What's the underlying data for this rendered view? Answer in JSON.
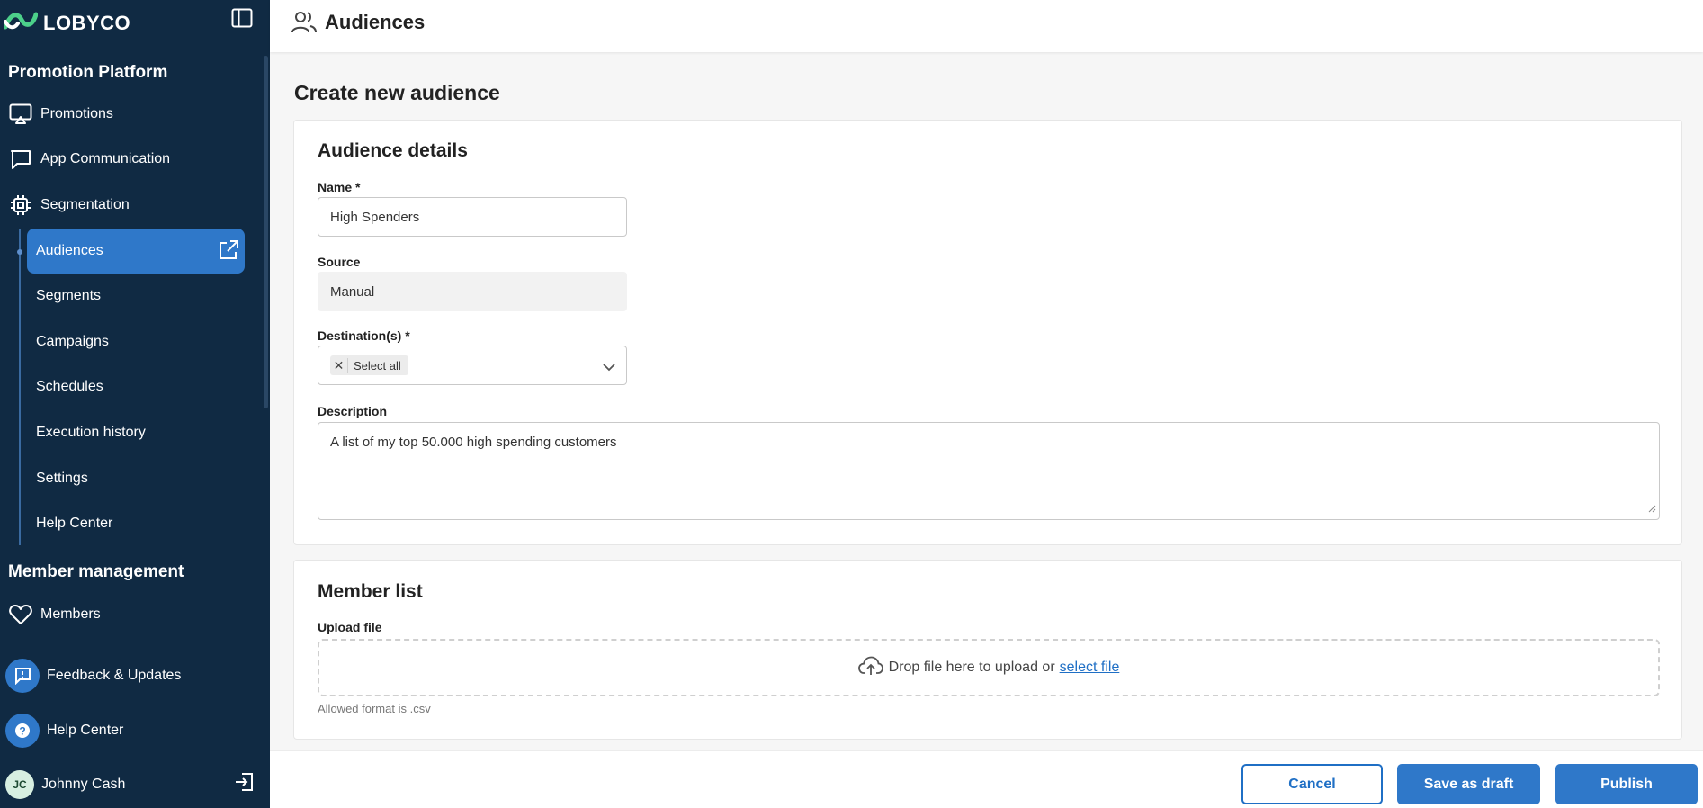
{
  "brand": {
    "name": "LOBYCO",
    "accent": "#2f78c9",
    "sidebar_bg": "#102a43"
  },
  "sidebar": {
    "section1_title": "Promotion Platform",
    "items": [
      {
        "label": "Promotions",
        "icon": "cast-icon"
      },
      {
        "label": "App Communication",
        "icon": "chat-icon"
      },
      {
        "label": "Segmentation",
        "icon": "chip-icon"
      }
    ],
    "sub_items": [
      {
        "label": "Audiences",
        "active": true
      },
      {
        "label": "Segments"
      },
      {
        "label": "Campaigns"
      },
      {
        "label": "Schedules"
      },
      {
        "label": "Execution history"
      },
      {
        "label": "Settings"
      },
      {
        "label": "Help Center"
      }
    ],
    "section2_title": "Member management",
    "members_label": "Members",
    "feedback_label": "Feedback & Updates",
    "help_label": "Help Center",
    "user": {
      "initials": "JC",
      "name": "Johnny Cash"
    }
  },
  "header": {
    "title": "Audiences"
  },
  "page": {
    "title": "Create new audience"
  },
  "details": {
    "title": "Audience details",
    "name_label": "Name *",
    "name_value": "High Spenders",
    "source_label": "Source",
    "source_value": "Manual",
    "destination_label": "Destination(s) *",
    "destination_chip": "Select all",
    "description_label": "Description",
    "description_value": "A list of my top 50.000 high spending customers"
  },
  "members": {
    "title": "Member list",
    "upload_label": "Upload file",
    "drop_text": "Drop file here to upload or",
    "select_link": "select file",
    "hint": "Allowed format is .csv"
  },
  "footer": {
    "cancel": "Cancel",
    "draft": "Save as draft",
    "publish": "Publish"
  }
}
